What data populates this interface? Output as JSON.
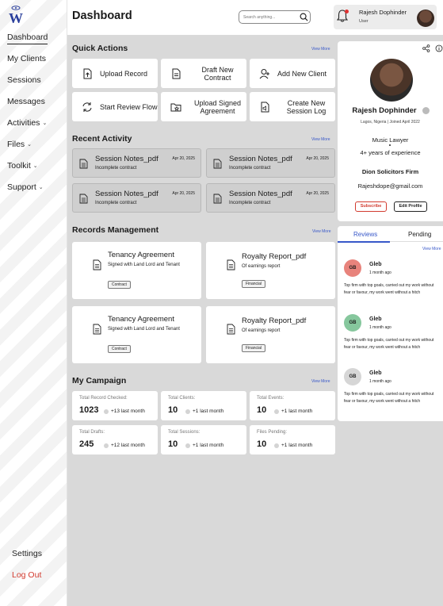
{
  "sidebar": {
    "logo_letter": "W",
    "items": [
      {
        "label": "Dashboard"
      },
      {
        "label": "My Clients"
      },
      {
        "label": "Sessions"
      },
      {
        "label": "Messages"
      },
      {
        "label": "Activities"
      },
      {
        "label": "Files"
      },
      {
        "label": "Toolkit"
      },
      {
        "label": "Support"
      }
    ],
    "settings": "Settings",
    "logout": "Log Out"
  },
  "header": {
    "title": "Dashboard",
    "search_placeholder": "Search anything...",
    "user_name": "Rajesh Dophinder",
    "user_role": "User"
  },
  "quick_actions": {
    "title": "Quick Actions",
    "view_more": "View More",
    "items": [
      {
        "label": "Upload Record",
        "icon": "upload-file-icon"
      },
      {
        "label": "Draft New Contract",
        "icon": "document-icon"
      },
      {
        "label": "Add New Client",
        "icon": "add-user-icon"
      },
      {
        "label": "Start Review Flow",
        "icon": "refresh-icon"
      },
      {
        "label": "Upload Signed Agreement",
        "icon": "folder-star-icon"
      },
      {
        "label": "Create New Session Log",
        "icon": "audio-file-icon"
      }
    ]
  },
  "recent_activity": {
    "title": "Recent Activity",
    "view_more": "View More",
    "items": [
      {
        "title": "Session Notes_pdf",
        "date": "Apr 20, 2025",
        "status": "Incomplete contract"
      },
      {
        "title": "Session Notes_pdf",
        "date": "Apr 20, 2025",
        "status": "Incomplete contract"
      },
      {
        "title": "Session Notes_pdf",
        "date": "Apr 20, 2025",
        "status": "Incomplete contract"
      },
      {
        "title": "Session Notes_pdf",
        "date": "Apr 20, 2025",
        "status": "Incomplete contract"
      }
    ]
  },
  "records": {
    "title": "Records Management",
    "view_more": "View More",
    "items": [
      {
        "title": "Tenancy Agreement",
        "desc": "Signed with Land Lord and Tenant",
        "tag": "Contract"
      },
      {
        "title": "Royalty Report_pdf",
        "desc": "Of earnings report",
        "tag": "Financial"
      },
      {
        "title": "Tenancy Agreement",
        "desc": "Signed with Land Lord and Tenant",
        "tag": "Contract"
      },
      {
        "title": "Royalty Report_pdf",
        "desc": "Of earnings report",
        "tag": "Financial"
      }
    ]
  },
  "campaign": {
    "title": "My Campaign",
    "view_more": "View More",
    "items": [
      {
        "label": "Total Record Checked:",
        "value": "1023",
        "change": "+13 last month"
      },
      {
        "label": "Total Clients:",
        "value": "10",
        "change": "+1 last month"
      },
      {
        "label": "Total Events:",
        "value": "10",
        "change": "+1 last month"
      },
      {
        "label": "Total Drafts:",
        "value": "245",
        "change": "+12 last month"
      },
      {
        "label": "Total Sessions:",
        "value": "10",
        "change": "+1 last month"
      },
      {
        "label": "Files Pending:",
        "value": "10",
        "change": "+1 last month"
      }
    ]
  },
  "profile": {
    "name": "Rajesh Dophinder",
    "location": "Lagos, Nigeria  |  Joined April 2022",
    "role": "Music Lawyer",
    "experience": "4+ years of experience",
    "firm": "Dion Solicitors Firm",
    "email": "Rajeshdope@gmail.com",
    "subscribe_label": "Subscribe",
    "edit_label": "Edit Profile"
  },
  "reviews": {
    "tabs": [
      "Reviews",
      "Pending"
    ],
    "view_more": "View More",
    "items": [
      {
        "initials": "GB",
        "name": "Gleb",
        "time": "1 month ago",
        "text": "Top firm with top goals, carried out my work without fear or favour, my work went without a hitch",
        "color": "#e8837c"
      },
      {
        "initials": "GB",
        "name": "Gleb",
        "time": "1 month ago",
        "text": "Top firm with top goals, carried out my work without fear or favour, my work went without a hitch",
        "color": "#86c79d"
      },
      {
        "initials": "GB",
        "name": "Gleb",
        "time": "1 month ago",
        "text": "Top firm with top goals, carried out my work without fear or favour, my work went without a hitch",
        "color": "#d6d6d6"
      }
    ]
  },
  "colors": {
    "accent": "#3858c9",
    "danger": "#d23b2f",
    "background": "#d9d9d9"
  }
}
